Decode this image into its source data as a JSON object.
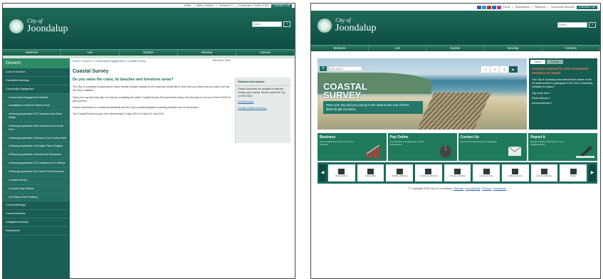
{
  "left": {
    "topbar": [
      "HOME",
      "EMPLOYMENT",
      "PAYMENTS",
      "COMMUNITY DIRECTORY"
    ],
    "contact_label": "CONTACT US",
    "logo": {
      "line1": "City of",
      "line2": "Joondalup"
    },
    "search_placeholder": "Search",
    "search_btn": "Go",
    "nav": [
      "Business",
      "Live",
      "Explore",
      "Develop",
      "Connect"
    ],
    "sidebar": {
      "heading": "Govern",
      "items": [
        {
          "label": "Code of Conduct",
          "sub": false
        },
        {
          "label": "Committee Meetings",
          "sub": false
        },
        {
          "label": "Community Engagement",
          "sub": false
        },
        {
          "label": "Community Engagement Network",
          "sub": true
        },
        {
          "label": "Installation of Vehicle Passive Kerb",
          "sub": true
        },
        {
          "label": "Planning application 242 Centenary Ave Eden Dingle",
          "sub": true
        },
        {
          "label": "Planning application 46A Cloudsmore at Ocean Reef",
          "sub": true
        },
        {
          "label": "Planning application 3 Stevens Court Ocean Reef",
          "sub": true
        },
        {
          "label": "Planning application 3 Kerrigan Place Kingsley",
          "sub": true
        },
        {
          "label": "Planning application Lakeview Ave Woodvale",
          "sub": true
        },
        {
          "label": "Planning application 102 Christchurch Dr Hillarys",
          "sub": true
        },
        {
          "label": "Planning application 119 Ocean Rd Greenwood",
          "sub": true
        },
        {
          "label": "Coastal Survey",
          "sub": true
        },
        {
          "label": "9 Austin Way Hillarys",
          "sub": true
        },
        {
          "label": "22 Ellison Drive Padbury",
          "sub": true
        },
        {
          "label": "Council Meetings",
          "sub": false
        },
        {
          "label": "Council Elections",
          "sub": false
        },
        {
          "label": "Delegated Authority",
          "sub": false
        },
        {
          "label": "Employment",
          "sub": false
        }
      ]
    },
    "breadcrumb": "Home » Govern » Community Engagement » Coastal Survey",
    "tools": "Print  A A+  RSS",
    "title": "Coastal Survey",
    "subtitle": "Do you value the coast, its beaches and foreshore areas?",
    "paragraphs": [
      "The City of Joondalup is planning for future climate change impacts on the coast and would like to hear from you about how you value and use the City's coastline.",
      "Have your say and help plan our way by completing the online Coastal Survey. All respondents will go into the draw to win one of three $100.00 gift vouchers.",
      "Further information on coastal sustainability and the City's coastal adaptation planning activities can be found here.",
      "The Coastal Survey is open from Wednesday 21 May 2014 to Friday 20 June 2014."
    ],
    "related": {
      "heading": "Related Information",
      "text": "Please documents are available in alternate formats upon request. Please contact the City on 9400 4000.",
      "links": [
        "Coastal Survey",
        "Coastal Climate Information"
      ]
    }
  },
  "right": {
    "topbar": [
      "Home",
      "Employment",
      "Payments",
      "Community Directory"
    ],
    "contact_label": "CONTACT US",
    "logo": {
      "line1": "City of",
      "line2": "Joondalup"
    },
    "search_placeholder": "Search",
    "search_btn": "Go",
    "nav": [
      "Business",
      "Live",
      "Explore",
      "Develop",
      "Connect"
    ],
    "hero": {
      "search_placeholder": "Enter search",
      "pages": [
        "1",
        "2",
        "3",
        "▶"
      ],
      "title1": "COASTAL",
      "title2": "SURVEY",
      "caption": "Have your say and you can go in the draw to win one of three $100.00 gift vouchers."
    },
    "news": {
      "tab1": "News",
      "tab2": "Events",
      "headline": "Artworks selected for 2014 Community Invitation Art Award",
      "para1": "The City of Joondalup has selected the winner of the 18 artists invited to participate in the 2014 Community Invitation Art Award.",
      "para2": "City of the Arts »",
      "para3": "Public Notices »",
      "para4": "Announcements »"
    },
    "tiles": [
      {
        "title": "Business",
        "text": "Drive, expand and future-proof your business"
      },
      {
        "title": "Pay Online",
        "text": "Council rates, infringements, animal registrations"
      },
      {
        "title": "Contact Us",
        "text": "Get in touch with the City of Joondalup"
      },
      {
        "title": "Report It",
        "text": "Report problems and issues in your neighbourhood"
      }
    ],
    "quick": [
      "Bin Collection",
      "Cycle Paths",
      "Facilities Booking",
      "Community Directory",
      "Libraries & Gallery",
      "Leisure Centres",
      "Online Services",
      "Events Calendar",
      "Rates"
    ],
    "footer": {
      "copyright": "© Copyright 2008 City of Joondalup",
      "links": [
        "Sitemap",
        "Accessibility",
        "Privacy",
        "Disclaimer"
      ]
    }
  }
}
